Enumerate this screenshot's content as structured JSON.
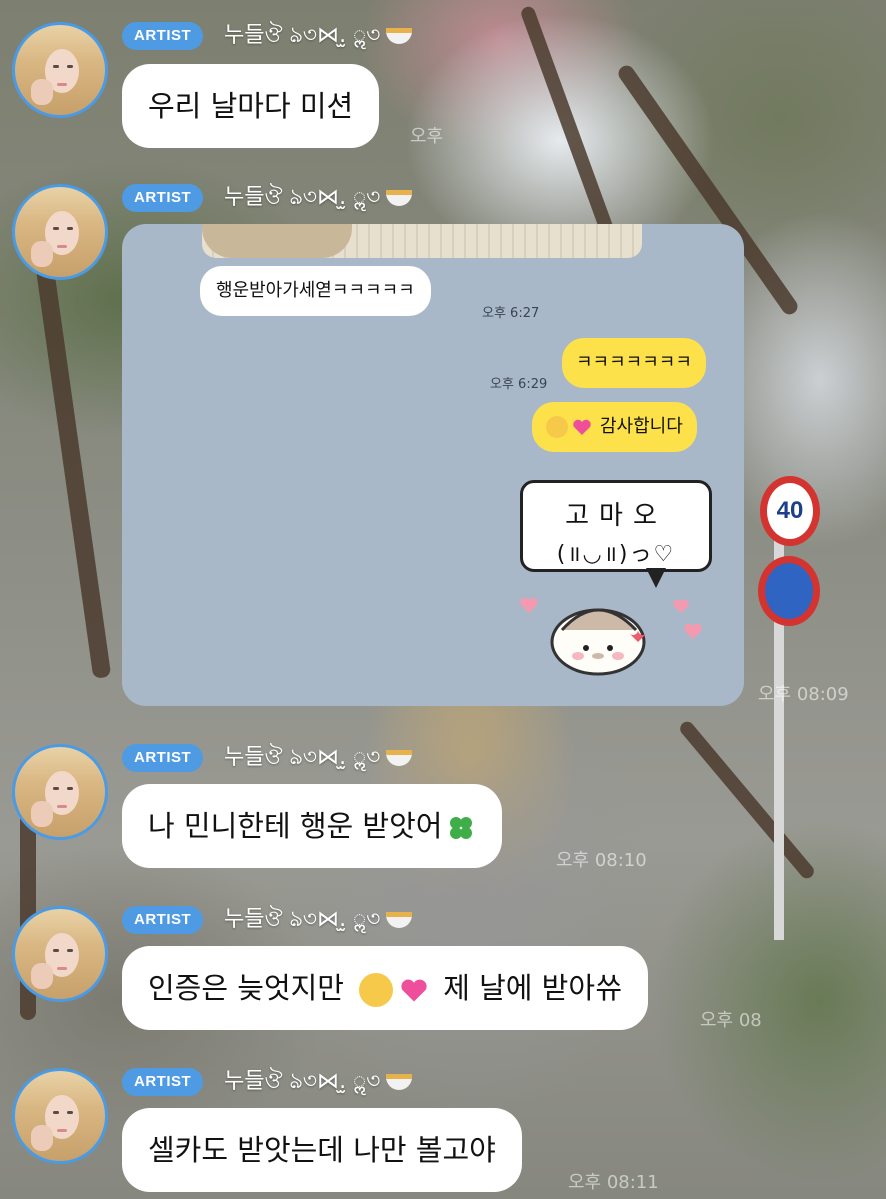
{
  "artist_badge": "ARTIST",
  "artist_name": "누들ঔ ঌ৩⋈.̫ ॢ৩",
  "messages": [
    {
      "text": "우리 날마다 미션",
      "time": "오후"
    },
    {
      "text": "나 민니한테 행운 받앗어",
      "time": "오후 08:10"
    },
    {
      "text": "인증은 늦엇지만",
      "text_after": "제 날에 받아쓔",
      "time": "오후 08"
    },
    {
      "text": "셀카도 받앗는데 나만 볼고야",
      "time": "오후 08:11"
    }
  ],
  "image_time": "오후 08:09",
  "screenshot_chat": {
    "incoming_text": "행운받아가세엳ㅋㅋㅋㅋㅋ",
    "incoming_time": "오후 6:27",
    "outgoing_time": "오후 6:29",
    "outgoing_1": "ㅋㅋㅋㅋㅋㅋㅋ",
    "outgoing_2": "감사합니다",
    "sticker_line1": "고마오",
    "sticker_line2": "(॥◡॥)っ♡"
  },
  "road_sign_speed": "40",
  "colors": {
    "badge": "#4e9be3",
    "outgoing_bubble": "#fde14a",
    "screenshot_bg": "#a8b8c8"
  }
}
